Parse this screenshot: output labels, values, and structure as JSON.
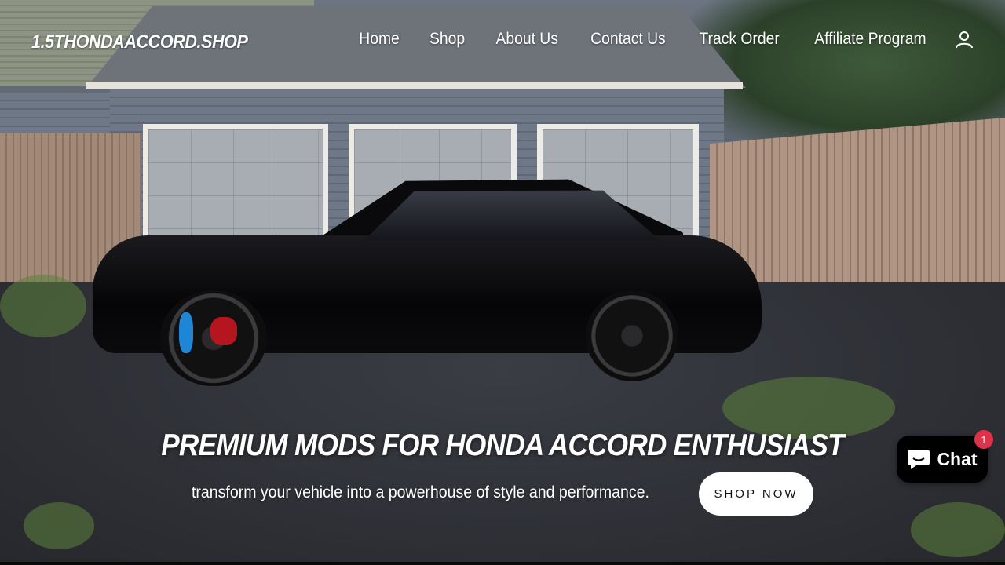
{
  "header": {
    "logo_text": "1.5THONDAACCORD.SHOP",
    "nav_items": [
      {
        "label": "Home"
      },
      {
        "label": "Shop"
      },
      {
        "label": "About Us"
      },
      {
        "label": "Contact Us"
      },
      {
        "label": "Track Order"
      },
      {
        "label": "Affiliate Program"
      }
    ],
    "account_icon": "user-account-icon"
  },
  "hero": {
    "heading": "PREMIUM MODS FOR HONDA ACCORD ENTHUSIAST",
    "subheading": "transform your vehicle into a powerhouse of style and performance.",
    "cta_label": "SHOP NOW",
    "background_image": "black-honda-accord-in-driveway"
  },
  "chat": {
    "label": "Chat",
    "badge_count": "1",
    "icon": "chat-bubble-icon",
    "badge_color": "#e0314b",
    "button_color": "#000000"
  }
}
